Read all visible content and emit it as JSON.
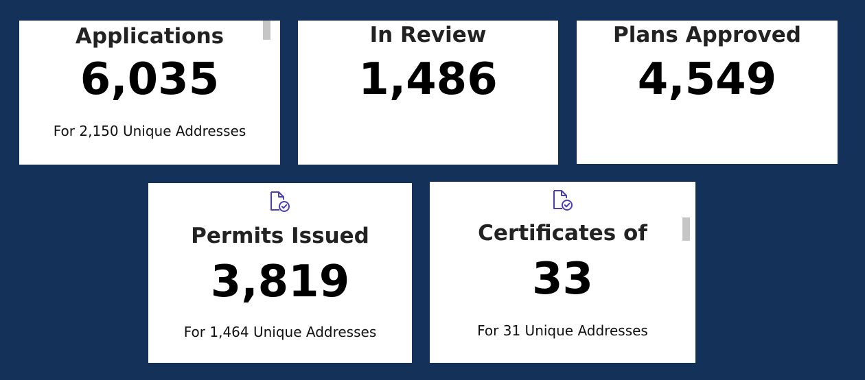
{
  "colors": {
    "background": "#14315a",
    "card": "#ffffff",
    "icon": "#4b3fb5",
    "scrollbar": "#c6c6c6"
  },
  "cards": [
    {
      "id": "applications",
      "title": "Applications",
      "value": "6,035",
      "subtitle": "For 2,150 Unique Addresses",
      "icon": null
    },
    {
      "id": "in-review",
      "title": "In Review",
      "value": "1,486",
      "subtitle": "",
      "icon": null
    },
    {
      "id": "plans-approved",
      "title": "Plans Approved",
      "value": "4,549",
      "subtitle": "",
      "icon": null
    },
    {
      "id": "permits-issued",
      "title": "Permits Issued",
      "value": "3,819",
      "subtitle": "For 1,464 Unique Addresses",
      "icon": "document-check-icon"
    },
    {
      "id": "certificates",
      "title": "Certificates of",
      "value": "33",
      "subtitle": "For 31 Unique Addresses",
      "icon": "document-check-icon"
    }
  ]
}
